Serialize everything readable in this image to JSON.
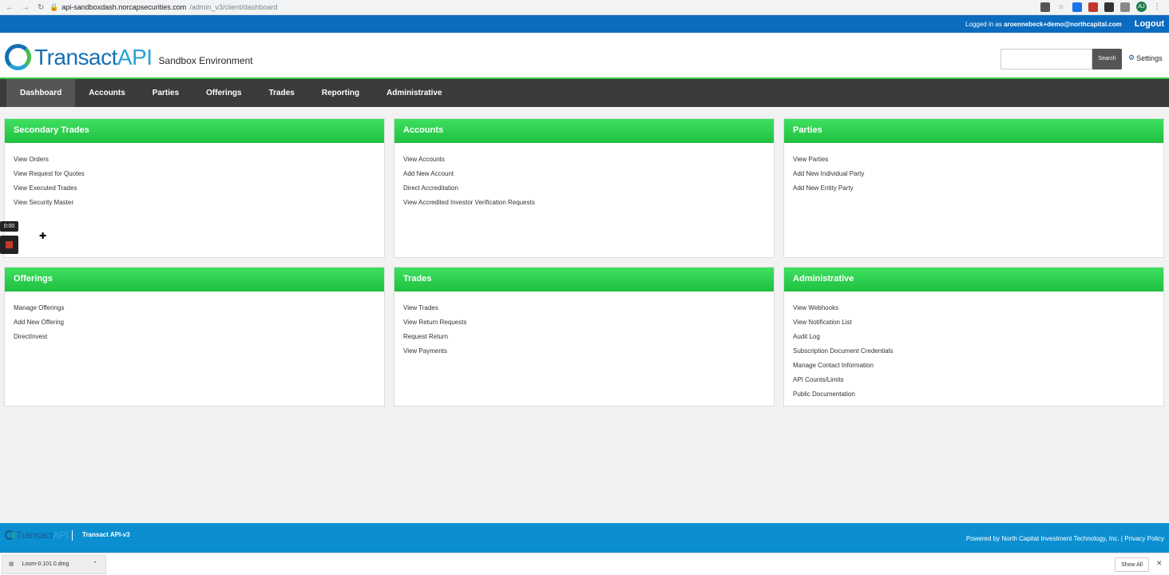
{
  "browser": {
    "url_host": "api-sandboxdash.norcapsecurities.com",
    "url_path": "/admin_v3/client/dashboard",
    "avatar": "AJ"
  },
  "topbar": {
    "logged_prefix": "Logged in as",
    "user": "aroennebeck+demo@northcapital.com",
    "logout": "Logout"
  },
  "header": {
    "logo_transact": "Transact",
    "logo_api": "API",
    "environment": "Sandbox Environment",
    "search_label": "Search",
    "settings_label": "Settings"
  },
  "nav": [
    "Dashboard",
    "Accounts",
    "Parties",
    "Offerings",
    "Trades",
    "Reporting",
    "Administrative"
  ],
  "panels": [
    {
      "title": "Secondary Trades",
      "links": [
        "View Orders",
        "View Request for Quotes",
        "View Executed Trades",
        "View Security Master"
      ]
    },
    {
      "title": "Accounts",
      "links": [
        "View Accounts",
        "Add New Account",
        "Direct Accreditation",
        "View Accredited Investor Verification Requests"
      ]
    },
    {
      "title": "Parties",
      "links": [
        "View Parties",
        "Add New Individual Party",
        "Add New Entity Party"
      ]
    },
    {
      "title": "Offerings",
      "links": [
        "Manage Offerings",
        "Add New Offering",
        "DirectInvest"
      ]
    },
    {
      "title": "Trades",
      "links": [
        "View Trades",
        "View Return Requests",
        "Request Return",
        "View Payments"
      ]
    },
    {
      "title": "Administrative",
      "links": [
        "View Webhooks",
        "View Notification List",
        "Audit Log",
        "Subscription Document Credentials",
        "Manage Contact Information",
        "API Counts/Limits",
        "Public Documentation"
      ]
    }
  ],
  "loom": {
    "time": "0:00"
  },
  "footer": {
    "logo_transact": "Transact",
    "logo_api": "API",
    "version": "Transact API-v3",
    "powered": "Powered by North Capital Investment Technology, Inc. | Privacy Policy"
  },
  "downloads": {
    "file": "Loom-0.101.0.dmg",
    "show_all": "Show All"
  }
}
